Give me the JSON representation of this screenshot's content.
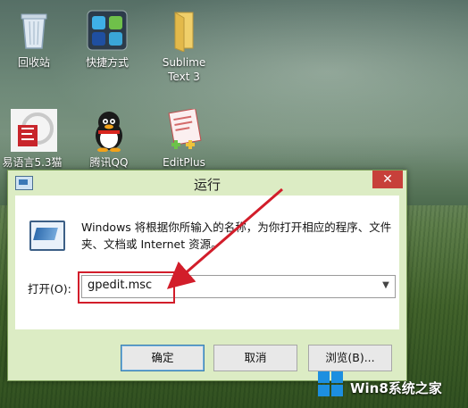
{
  "desktop": {
    "icons": [
      {
        "label": "回收站"
      },
      {
        "label": "快捷方式"
      },
      {
        "label": "Sublime",
        "label2": "Text 3"
      },
      {
        "label": "易语言5.3猫"
      },
      {
        "label": "腾讯QQ"
      },
      {
        "label": "EditPlus"
      }
    ]
  },
  "dialog": {
    "title": "运行",
    "close_label": "✕",
    "description": "Windows 将根据你所输入的名称，为你打开相应的程序、文件夹、文档或 Internet 资源。",
    "open_label": "打开(O):",
    "input_value": "gpedit.msc",
    "ok_label": "确定",
    "cancel_label": "取消",
    "browse_label": "浏览(B)...",
    "highlight_color": "#d21d2a"
  },
  "watermark": {
    "text": "Win8系统之家",
    "logo_color": "#1d8fe0"
  }
}
